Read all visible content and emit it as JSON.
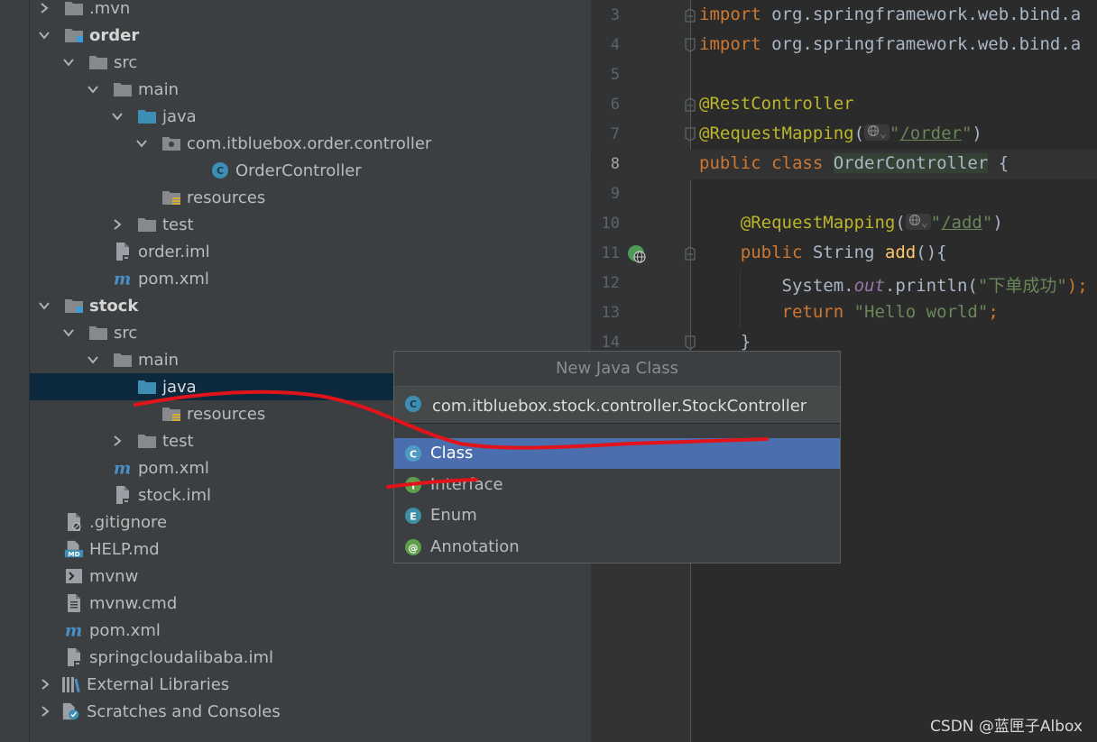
{
  "project_tree": {
    "rows": [
      {
        "label": ".mvn",
        "icon": "folder-icon",
        "arrow": "collapsed"
      },
      {
        "label": "order",
        "icon": "module-folder-icon",
        "arrow": "expanded"
      },
      {
        "label": "src",
        "icon": "folder-icon",
        "arrow": "expanded"
      },
      {
        "label": "main",
        "icon": "folder-icon",
        "arrow": "expanded"
      },
      {
        "label": "java",
        "icon": "source-folder-icon",
        "arrow": "expanded"
      },
      {
        "label": "com.itbluebox.order.controller",
        "icon": "package-icon",
        "arrow": "expanded"
      },
      {
        "label": "OrderController",
        "icon": "java-class-icon"
      },
      {
        "label": "resources",
        "icon": "resources-folder-icon"
      },
      {
        "label": "test",
        "icon": "folder-icon",
        "arrow": "collapsed"
      },
      {
        "label": "order.iml",
        "icon": "iml-file-icon"
      },
      {
        "label": "pom.xml",
        "icon": "maven-icon"
      },
      {
        "label": "stock",
        "icon": "module-folder-icon",
        "arrow": "expanded"
      },
      {
        "label": "src",
        "icon": "folder-icon",
        "arrow": "expanded"
      },
      {
        "label": "main",
        "icon": "folder-icon",
        "arrow": "expanded"
      },
      {
        "label": "java",
        "icon": "source-folder-icon"
      },
      {
        "label": "resources",
        "icon": "resources-folder-icon"
      },
      {
        "label": "test",
        "icon": "folder-icon",
        "arrow": "collapsed"
      },
      {
        "label": "pom.xml",
        "icon": "maven-icon"
      },
      {
        "label": "stock.iml",
        "icon": "iml-file-icon"
      },
      {
        "label": ".gitignore",
        "icon": "gitignore-file-icon"
      },
      {
        "label": "HELP.md",
        "icon": "markdown-file-icon"
      },
      {
        "label": "mvnw",
        "icon": "shell-script-icon"
      },
      {
        "label": "mvnw.cmd",
        "icon": "text-file-icon"
      },
      {
        "label": "pom.xml",
        "icon": "maven-icon"
      },
      {
        "label": "springcloudalibaba.iml",
        "icon": "iml-file-icon"
      },
      {
        "label": "External Libraries",
        "icon": "libraries-icon",
        "arrow": "collapsed"
      },
      {
        "label": "Scratches and Consoles",
        "icon": "scratches-icon",
        "arrow": "collapsed"
      }
    ]
  },
  "editor": {
    "lines": [
      {
        "num": "3"
      },
      {
        "num": "4"
      },
      {
        "num": "5"
      },
      {
        "num": "6"
      },
      {
        "num": "7"
      },
      {
        "num": "8"
      },
      {
        "num": "9"
      },
      {
        "num": "10"
      },
      {
        "num": "11"
      },
      {
        "num": "12"
      },
      {
        "num": "13"
      },
      {
        "num": "14"
      }
    ],
    "code": {
      "l3_kw": "import",
      "l3_rest": " org.springframework.web.bind.a",
      "l4_kw": "import",
      "l4_rest": " org.springframework.web.bind.a",
      "l6_ann": "@RestController",
      "l7_ann": "@RequestMapping",
      "l7_paren_open": "(",
      "l7_q1": "\"",
      "l7_path": "/order",
      "l7_q2": "\"",
      "l7_paren_close": ")",
      "l8_kw1": "public",
      "l8_kw2": " class ",
      "l8_cls": "OrderController",
      "l8_brace": " {",
      "l10_ann": "@RequestMapping",
      "l10_paren_open": "(",
      "l10_q1": "\"",
      "l10_path": "/add",
      "l10_q2": "\"",
      "l10_paren_close": ")",
      "l11_kw": "public",
      "l11_type": " String ",
      "l11_fn": "add",
      "l11_rest": "(){",
      "l12_sys": "System.",
      "l12_out": "out",
      "l12_call": ".println(",
      "l12_str": "\"下单成功\"",
      "l12_end": ");",
      "l13_kw": "return",
      "l13_str": " \"Hello world\"",
      "l13_semi": ";",
      "l14_brace": "}"
    }
  },
  "popup": {
    "title": "New Java Class",
    "input_value": "com.itbluebox.stock.controller.StockController",
    "kinds": [
      {
        "label": "Class",
        "letter": "C",
        "color": "#4f9bc3",
        "selected": true
      },
      {
        "label": "Interface",
        "letter": "I",
        "color": "#5f9f4b",
        "selected": false
      },
      {
        "label": "Enum",
        "letter": "E",
        "color": "#3f8ea8",
        "selected": false
      },
      {
        "label": "Annotation",
        "letter": "@",
        "color": "#5f9f4b",
        "selected": false
      }
    ]
  },
  "watermark": "CSDN @蓝匣子Albox",
  "colors": {
    "selection": "#4b6eaf",
    "annotation_stroke": "#e8151b"
  }
}
